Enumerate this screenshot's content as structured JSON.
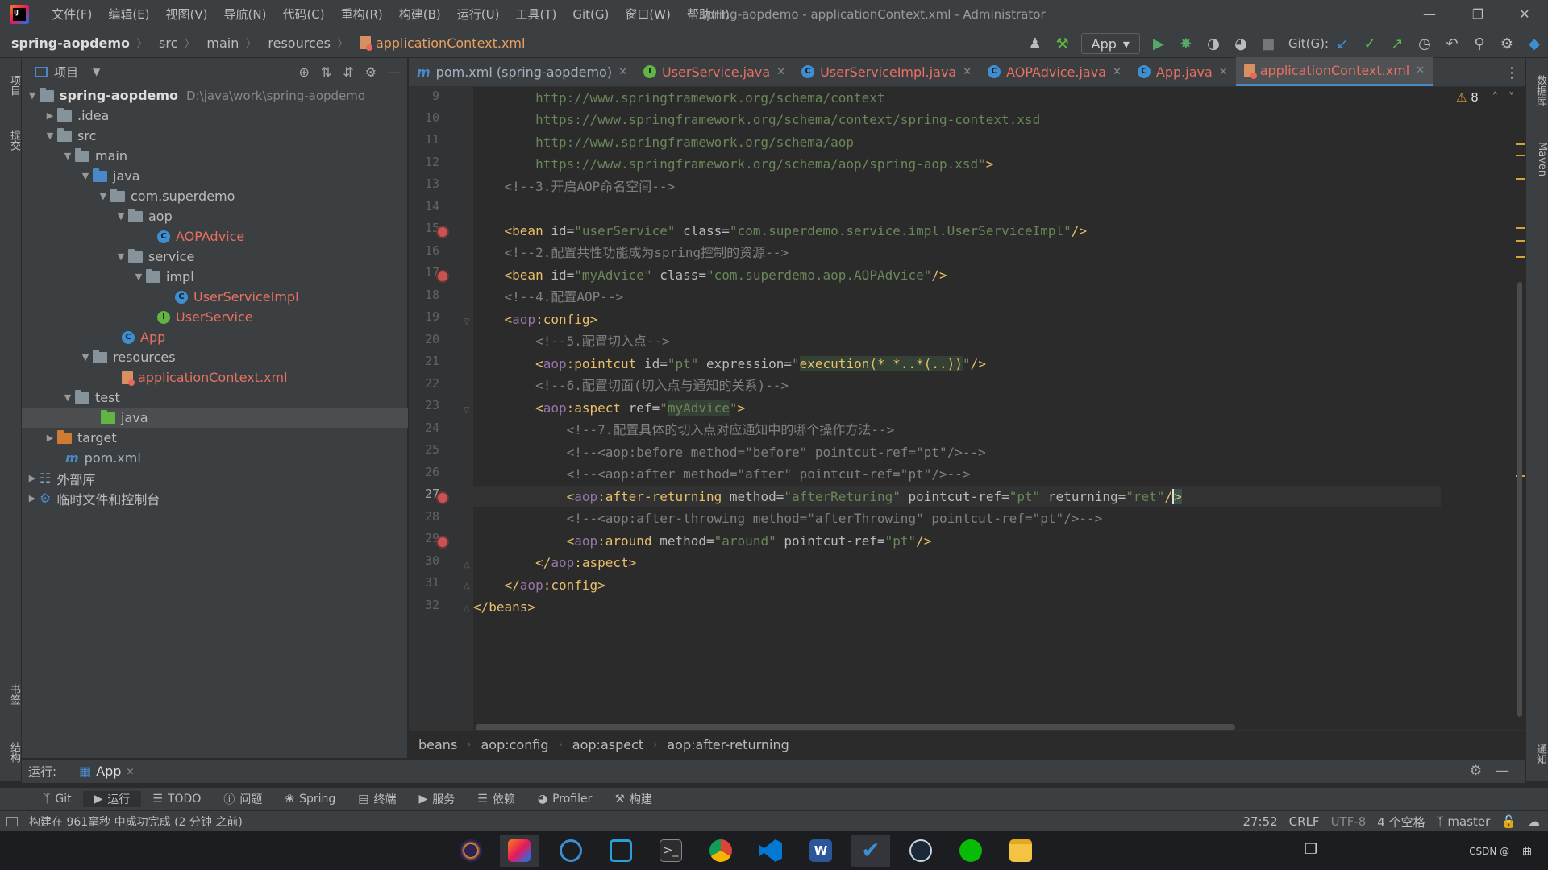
{
  "window": {
    "menu": [
      "文件(F)",
      "编辑(E)",
      "视图(V)",
      "导航(N)",
      "代码(C)",
      "重构(R)",
      "构建(B)",
      "运行(U)",
      "工具(T)",
      "Git(G)",
      "窗口(W)",
      "帮助(H)"
    ],
    "title": "spring-aopdemo - applicationContext.xml - Administrator"
  },
  "nav": {
    "breadcrumbs": [
      "spring-aopdemo",
      "src",
      "main",
      "resources",
      "applicationContext.xml"
    ],
    "run_config": "App",
    "git_label": "Git(G):"
  },
  "side": {
    "left_tabs": [
      "项目",
      "提交",
      "书签",
      "结构"
    ],
    "right_tabs": [
      "数据库",
      "Maven",
      "通知"
    ]
  },
  "project": {
    "panel_title": "项目",
    "tree": [
      {
        "label": "spring-aopdemo",
        "path": "D:\\java\\work\\spring-aopdemo",
        "icon": "module-folder"
      },
      {
        "label": ".idea",
        "icon": "folder"
      },
      {
        "label": "src",
        "icon": "folder"
      },
      {
        "label": "main",
        "icon": "folder"
      },
      {
        "label": "java",
        "icon": "source-folder"
      },
      {
        "label": "com.superdemo",
        "icon": "package"
      },
      {
        "label": "aop",
        "icon": "package"
      },
      {
        "label": "AOPAdvice",
        "icon": "class"
      },
      {
        "label": "service",
        "icon": "package"
      },
      {
        "label": "impl",
        "icon": "package"
      },
      {
        "label": "UserServiceImpl",
        "icon": "class"
      },
      {
        "label": "UserService",
        "icon": "interface"
      },
      {
        "label": "App",
        "icon": "app-class"
      },
      {
        "label": "resources",
        "icon": "resources-folder"
      },
      {
        "label": "applicationContext.xml",
        "icon": "xml-file"
      },
      {
        "label": "test",
        "icon": "folder"
      },
      {
        "label": "java",
        "icon": "test-folder"
      },
      {
        "label": "target",
        "icon": "excluded-folder"
      },
      {
        "label": "pom.xml",
        "icon": "maven-file"
      },
      {
        "label": "外部库",
        "icon": "library"
      },
      {
        "label": "临时文件和控制台",
        "icon": "scratches"
      }
    ]
  },
  "tabs": [
    {
      "label": "pom.xml (spring-aopdemo)",
      "icon": "maven-icon"
    },
    {
      "label": "UserService.java",
      "icon": "interface-icon"
    },
    {
      "label": "UserServiceImpl.java",
      "icon": "class-icon"
    },
    {
      "label": "AOPAdvice.java",
      "icon": "class-icon"
    },
    {
      "label": "App.java",
      "icon": "class-icon"
    },
    {
      "label": "applicationContext.xml",
      "icon": "xml-icon"
    }
  ],
  "editor": {
    "warning_count": "8",
    "line_numbers": [
      "9",
      "10",
      "11",
      "12",
      "13",
      "14",
      "15",
      "16",
      "17",
      "18",
      "19",
      "20",
      "21",
      "22",
      "23",
      "24",
      "25",
      "26",
      "27",
      "28",
      "29",
      "30",
      "31",
      "32"
    ],
    "code": {
      "l9": "http://www.springframework.org/schema/context",
      "l10": "https://www.springframework.org/schema/context/spring-context.xsd",
      "l11": "http://www.springframework.org/schema/aop",
      "l12": "https://www.springframework.org/schema/aop/spring-aop.xsd",
      "l13": "<!--3.开启AOP命名空间-->",
      "l15_a": "userService",
      "l15_b": "com.superdemo.service.impl.UserServiceImpl",
      "l16": "<!--2.配置共性功能成为spring控制的资源-->",
      "l17_a": "myAdvice",
      "l17_b": "com.superdemo.aop.AOPAdvice",
      "l18": "<!--4.配置AOP-->",
      "l20": "<!--5.配置切入点-->",
      "l21_a": "pt",
      "l21_b": "execution(* *..*(..))",
      "l22": "<!--6.配置切面(切入点与通知的关系)-->",
      "l23_a": "myAdvice",
      "l24": "<!--7.配置具体的切入点对应通知中的哪个操作方法-->",
      "l25": "<!--<aop:before method=\"before\" pointcut-ref=\"pt\"/>-->",
      "l26": "<!--<aop:after method=\"after\" pointcut-ref=\"pt\"/>-->",
      "l27_a": "afterReturing",
      "l27_b": "pt",
      "l27_c": "ret",
      "l28": "<!--<aop:after-throwing method=\"afterThrowing\" pointcut-ref=\"pt\"/>-->",
      "l29_a": "around",
      "l29_b": "pt"
    }
  },
  "structure_breadcrumbs": [
    "beans",
    "aop:config",
    "aop:aspect",
    "aop:after-returning"
  ],
  "run": {
    "label": "运行:",
    "tab": "App"
  },
  "tool_windows": [
    "Git",
    "运行",
    "TODO",
    "问题",
    "Spring",
    "终端",
    "服务",
    "依赖",
    "Profiler",
    "构建"
  ],
  "status": {
    "message": "构建在 961毫秒 中成功完成 (2 分钟 之前)",
    "position": "27:52",
    "line_sep": "CRLF",
    "encoding": "UTF-8",
    "indent": "4 个空格",
    "branch": "master"
  },
  "taskbar": {
    "watermark": "CSDN @ 一曲",
    "apps": [
      "eclipse-icon",
      "intellij-icon",
      "vmware-icon",
      "app-icon",
      "terminal-icon",
      "chrome-icon",
      "vscode-icon",
      "word-icon",
      "todo-icon",
      "steam-icon",
      "wechat-icon",
      "explorer-icon"
    ]
  }
}
